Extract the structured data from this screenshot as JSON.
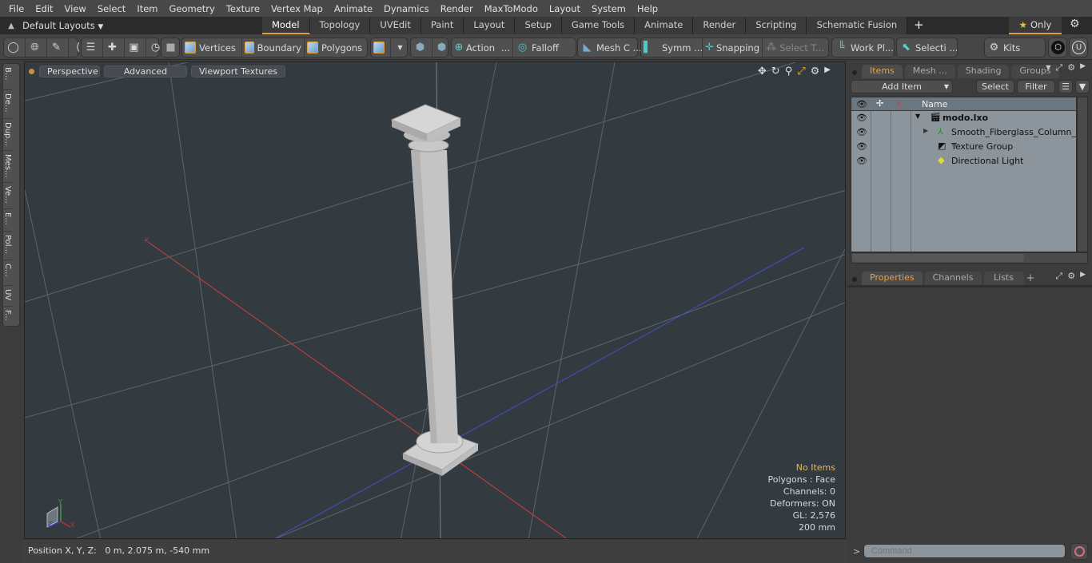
{
  "menu": [
    "File",
    "Edit",
    "View",
    "Select",
    "Item",
    "Geometry",
    "Texture",
    "Vertex Map",
    "Animate",
    "Dynamics",
    "Render",
    "MaxToModo",
    "Layout",
    "System",
    "Help"
  ],
  "layoutbar": {
    "layouts_label": "Default Layouts",
    "tabs": [
      "Model",
      "Topology",
      "UVEdit",
      "Paint",
      "Layout",
      "Setup",
      "Game Tools",
      "Animate",
      "Render",
      "Scripting",
      "Schematic Fusion"
    ],
    "active_tab": "Model",
    "add_tab": "+",
    "only_label": "Only"
  },
  "toolbar": {
    "vertices": "Vertices",
    "boundary": "Boundary",
    "polygons": "Polygons",
    "action": "Action",
    "action_more": "...",
    "falloff": "Falloff",
    "mesh_c": "Mesh C ...",
    "symm": "Symm ...",
    "snapping": "Snapping",
    "select_t": "Select T...",
    "work_pl": "Work Pl...",
    "selecti": "Selecti ...",
    "kits": "Kits"
  },
  "left_tools": [
    "B...",
    "De...",
    "Dup...",
    "Mes...",
    "Ve...",
    "E...",
    "Pol...",
    "C...",
    "UV",
    "F..."
  ],
  "viewport": {
    "tabs": [
      "Perspective",
      "Advanced",
      "Viewport Textures"
    ],
    "axis_labels": {
      "x": "X",
      "y": "Y",
      "z": "Z"
    },
    "info": {
      "items": "No Items",
      "polygons": "Polygons : Face",
      "channels": "Channels: 0",
      "deformers": "Deformers: ON",
      "gl": "GL: 2,576",
      "scale": "200 mm"
    },
    "colors": {
      "background": "#343b40",
      "x_axis": "#c84040",
      "z_axis": "#4050c8",
      "warn_text": "#e8b850"
    }
  },
  "status": {
    "position_label": "Position X, Y, Z:",
    "position_value": "0 m, 2.075 m, -540 mm"
  },
  "items_panel": {
    "tabs": [
      "Items",
      "Mesh ...",
      "Shading",
      "Groups"
    ],
    "active_tab": "Items",
    "add_item": "Add Item",
    "select": "Select",
    "filter": "Filter",
    "column_name": "Name",
    "rows": [
      {
        "name": "modo.lxo",
        "type": "scene",
        "bold": true
      },
      {
        "name": "Smooth_Fiberglass_Column_ ...",
        "type": "mesh",
        "bold": false
      },
      {
        "name": "Texture Group",
        "type": "texture-group",
        "bold": false
      },
      {
        "name": "Directional Light",
        "type": "light",
        "bold": false
      }
    ]
  },
  "properties_panel": {
    "tabs": [
      "Properties",
      "Channels",
      "Lists"
    ],
    "active_tab": "Properties",
    "add_tab": "+"
  },
  "command": {
    "prompt": ">",
    "placeholder": "Command"
  }
}
